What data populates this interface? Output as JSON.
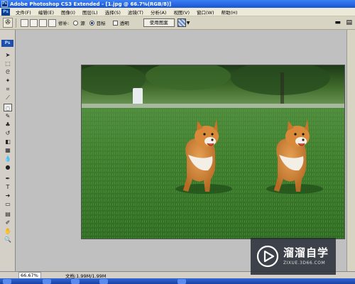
{
  "window": {
    "title": "Adobe Photoshop CS3 Extended - [1.jpg @ 66.7%(RGB/8)]"
  },
  "menu": {
    "items": [
      "文件(F)",
      "编辑(E)",
      "图像(I)",
      "图层(L)",
      "选择(S)",
      "滤镜(T)",
      "分析(A)",
      "视图(V)",
      "窗口(W)",
      "帮助(H)"
    ]
  },
  "options": {
    "repair_label": "修补:",
    "source_label": "源",
    "target_label": "目标",
    "transparent_label": "透明",
    "use_pattern_button": "使用图案",
    "selected_mode": "目标"
  },
  "toolbox": {
    "badge": "Ps"
  },
  "status": {
    "zoom": "66.67%",
    "doc_info": "文档:1.99M/1.99M"
  },
  "watermark": {
    "name": "溜溜自学",
    "url": "ZIXUE.3D66.COM"
  },
  "colors": {
    "title_bar": "#2a6ae6",
    "foreground": "#000000",
    "background": "#ffffff",
    "workspace": "#c0c0c0"
  }
}
